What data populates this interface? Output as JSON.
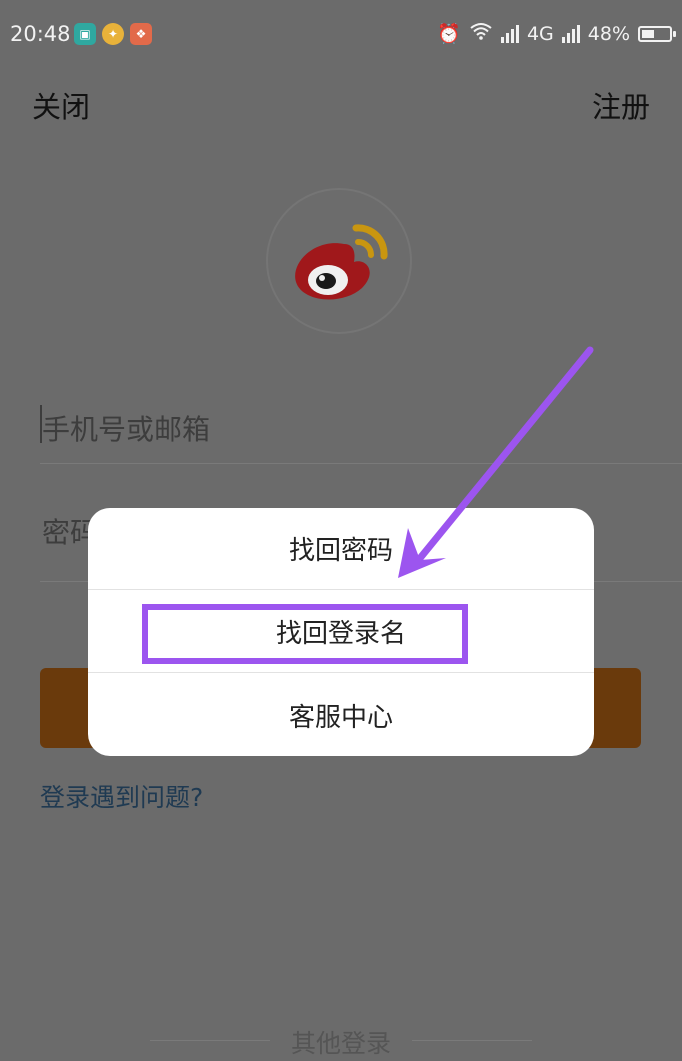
{
  "status_bar": {
    "time": "20:48",
    "network": "4G",
    "battery": "48%",
    "battery_level": 0.48,
    "icons": [
      "screenshot-icon",
      "app-icon",
      "gallery-icon",
      "alarm-icon",
      "wifi-icon",
      "signal-icon",
      "battery-icon"
    ]
  },
  "header": {
    "close_label": "关闭",
    "register_label": "注册"
  },
  "logo": {
    "icon": "weibo-logo-icon"
  },
  "form": {
    "phone_placeholder": "手机号或邮箱",
    "password_placeholder": "密码"
  },
  "help_link": "登录遇到问题?",
  "other_login": "其他登录",
  "popup": {
    "items": [
      {
        "label": "找回密码"
      },
      {
        "label": "找回登录名"
      },
      {
        "label": "客服中心"
      }
    ]
  },
  "annotation": {
    "highlight_color": "#9c55ef",
    "arrow_color": "#9c55ef"
  },
  "colors": {
    "login_button": "#6a3a0c",
    "overlay": "#6b6b6b",
    "link": "#1f3a52"
  }
}
